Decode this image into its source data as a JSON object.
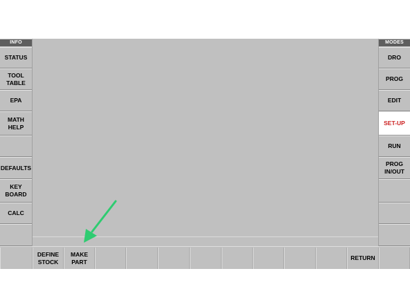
{
  "info_panel": {
    "header": "INFO",
    "buttons": [
      {
        "label": "STATUS"
      },
      {
        "label": "TOOL\nTABLE"
      },
      {
        "label": "EPA"
      },
      {
        "label": "MATH\nHELP"
      },
      {
        "label": ""
      },
      {
        "label": "DEFAULTS"
      },
      {
        "label": "KEY\nBOARD"
      },
      {
        "label": "CALC"
      },
      {
        "label": ""
      }
    ]
  },
  "modes_panel": {
    "header": "MODES",
    "buttons": [
      {
        "label": "DRO"
      },
      {
        "label": "PROG"
      },
      {
        "label": "EDIT"
      },
      {
        "label": "SET-UP",
        "active": true
      },
      {
        "label": "RUN"
      },
      {
        "label": "PROG\nIN/OUT"
      },
      {
        "label": ""
      },
      {
        "label": ""
      },
      {
        "label": ""
      }
    ]
  },
  "soft_keys": [
    {
      "label": ""
    },
    {
      "label": "DEFINE\nSTOCK"
    },
    {
      "label": "MAKE\nPART"
    },
    {
      "label": ""
    },
    {
      "label": ""
    },
    {
      "label": ""
    },
    {
      "label": ""
    },
    {
      "label": ""
    },
    {
      "label": ""
    },
    {
      "label": ""
    },
    {
      "label": ""
    },
    {
      "label": "RETURN"
    },
    {
      "label": ""
    }
  ],
  "colors": {
    "panel_bg": "#c0c0c0",
    "header_bg": "#5e5e5e",
    "active_text": "#cc2222",
    "annotation_arrow": "#2ecc71"
  },
  "annotation": {
    "icon": "pointer-arrow-icon"
  }
}
